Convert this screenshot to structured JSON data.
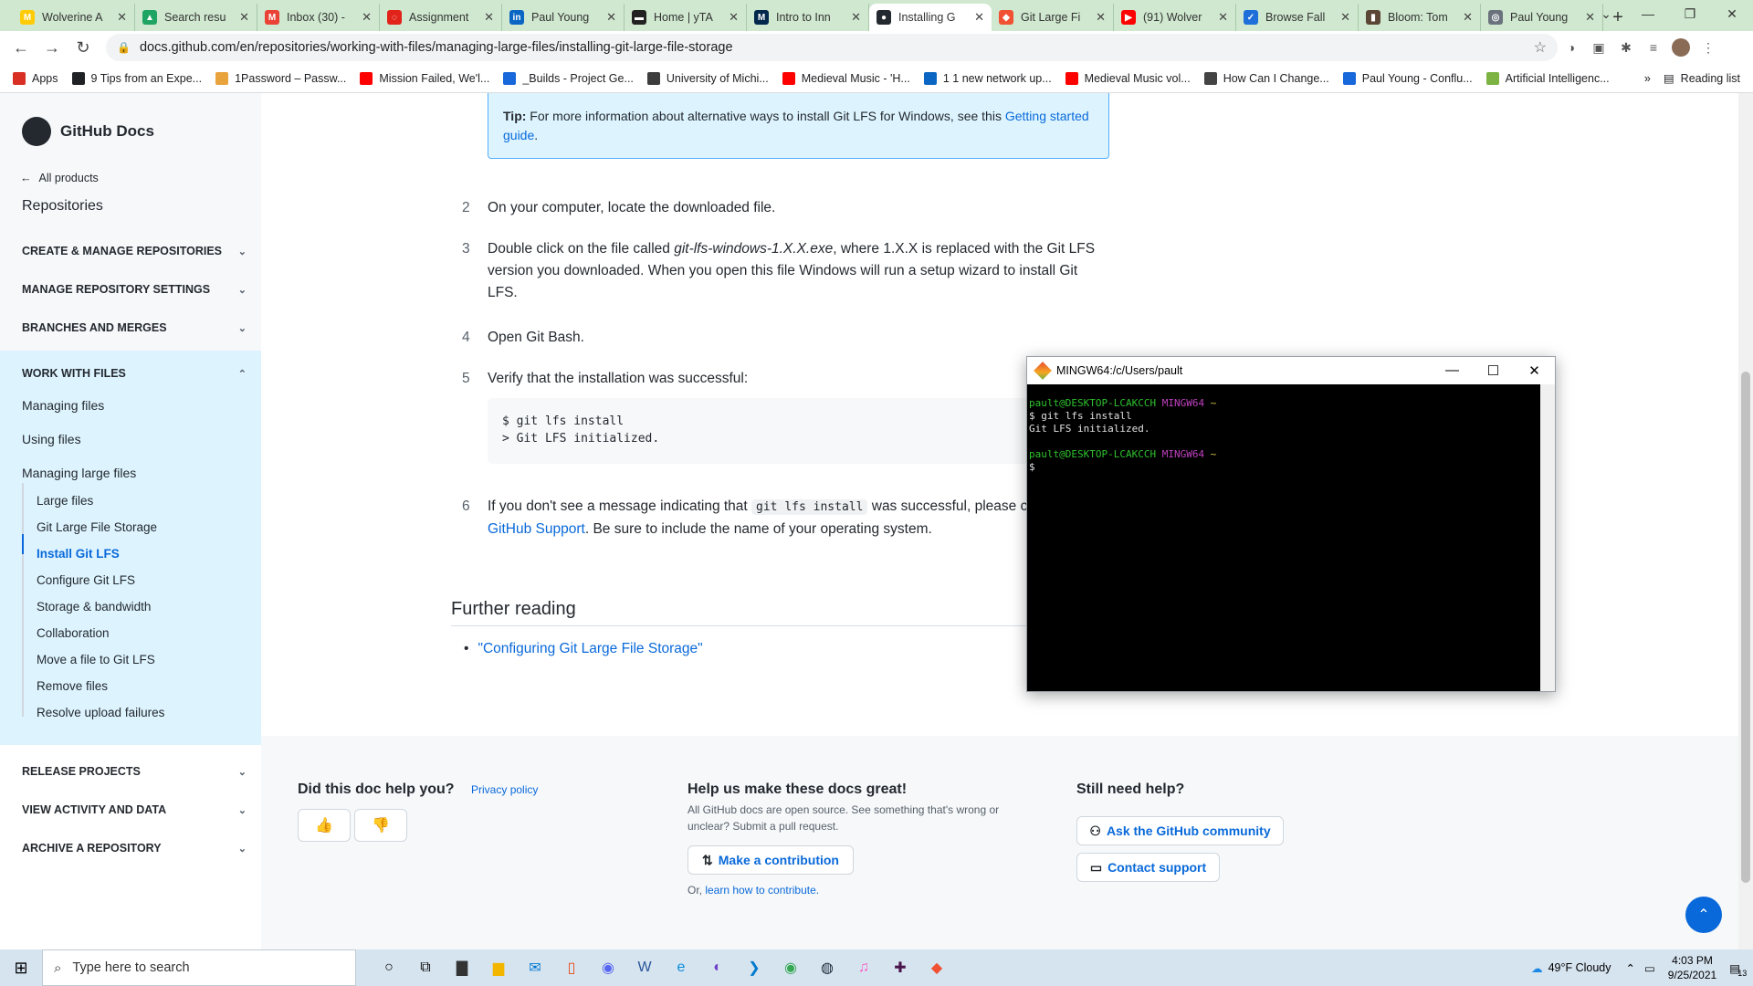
{
  "browser": {
    "tabs": [
      {
        "title": "Wolverine A",
        "fav_color": "#ffcb05",
        "fav_text": "M"
      },
      {
        "title": "Search resu",
        "fav_color": "#1fa463",
        "fav_text": "▲"
      },
      {
        "title": "Inbox (30) -",
        "fav_color": "#ea4335",
        "fav_text": "M"
      },
      {
        "title": "Assignment",
        "fav_color": "#e2231a",
        "fav_text": "◌"
      },
      {
        "title": "Paul Young",
        "fav_color": "#0a66c2",
        "fav_text": "in"
      },
      {
        "title": "Home | yTA",
        "fav_color": "#222222",
        "fav_text": "▬"
      },
      {
        "title": "Intro to Inn",
        "fav_color": "#00274c",
        "fav_text": "M"
      },
      {
        "title": "Installing G",
        "fav_color": "#24292f",
        "fav_text": "●",
        "active": true
      },
      {
        "title": "Git Large Fi",
        "fav_color": "#f05133",
        "fav_text": "◆"
      },
      {
        "title": "(91) Wolver",
        "fav_color": "#ff0000",
        "fav_text": "▶"
      },
      {
        "title": "Browse Fall",
        "fav_color": "#1e6fd9",
        "fav_text": "✓"
      },
      {
        "title": "Bloom: Tom",
        "fav_color": "#5b4636",
        "fav_text": "▮"
      },
      {
        "title": "Paul Young",
        "fav_color": "#6a737d",
        "fav_text": "◎"
      }
    ],
    "url": "docs.github.com/en/repositories/working-with-files/managing-large-files/installing-git-large-file-storage",
    "bookmarks": [
      {
        "label": "Apps",
        "color": "#d93025"
      },
      {
        "label": "9 Tips from an Expe...",
        "color": "#202124"
      },
      {
        "label": "1Password – Passw...",
        "color": "#e8a33d"
      },
      {
        "label": "Mission Failed, We'l...",
        "color": "#ff0000"
      },
      {
        "label": "_Builds - Project Ge...",
        "color": "#1868db"
      },
      {
        "label": "University of Michi...",
        "color": "#3c3c3c"
      },
      {
        "label": "Medieval Music - 'H...",
        "color": "#ff0000"
      },
      {
        "label": "1 1 new network up...",
        "color": "#0a66c2"
      },
      {
        "label": "Medieval Music vol...",
        "color": "#ff0000"
      },
      {
        "label": "How Can I Change...",
        "color": "#444444"
      },
      {
        "label": "Paul Young - Conflu...",
        "color": "#1868db"
      },
      {
        "label": "Artificial Intelligenc...",
        "color": "#7cb342"
      }
    ],
    "bookmarks_more": "»",
    "reading_list": "Reading list"
  },
  "sidebar": {
    "logo_text": "GitHub Docs",
    "all_products": "All products",
    "title": "Repositories",
    "sections_top": [
      {
        "label": "CREATE & MANAGE REPOSITORIES"
      },
      {
        "label": "MANAGE REPOSITORY SETTINGS"
      },
      {
        "label": "BRANCHES AND MERGES"
      }
    ],
    "work_with_files": {
      "label": "WORK WITH FILES",
      "items": [
        "Managing files",
        "Using files",
        "Managing large files"
      ],
      "subitems": [
        "Large files",
        "Git Large File Storage",
        "Install Git LFS",
        "Configure Git LFS",
        "Storage & bandwidth",
        "Collaboration",
        "Move a file to Git LFS",
        "Remove files",
        "Resolve upload failures"
      ]
    },
    "sections_bottom": [
      {
        "label": "RELEASE PROJECTS"
      },
      {
        "label": "VIEW ACTIVITY AND DATA"
      },
      {
        "label": "ARCHIVE A REPOSITORY"
      }
    ]
  },
  "main": {
    "tip_prefix": "Tip:",
    "tip_text": " For more information about alternative ways to install Git LFS for Windows, see this ",
    "tip_link": "Getting started guide",
    "tip_suffix": ".",
    "step2_num": "2",
    "step2": "On your computer, locate the downloaded file.",
    "step3_num": "3",
    "step3_a": "Double click on the file called ",
    "step3_file": "git-lfs-windows-1.X.X.exe",
    "step3_b": ", where 1.X.X is replaced with the Git LFS version you downloaded. When you open this file Windows will run a setup wizard to install Git LFS.",
    "step4_num": "4",
    "step4": "Open Git Bash.",
    "step5_num": "5",
    "step5": "Verify that the installation was successful:",
    "code_line1": "$ git lfs install",
    "code_line2": "> Git LFS initialized.",
    "step6_num": "6",
    "step6_a": "If you don't see a message indicating that ",
    "step6_code": "git lfs install",
    "step6_b": " was successful, please contact ",
    "step6_link": "GitHub Support",
    "step6_c": ". Be sure to include the name of your operating system.",
    "further_heading": "Further reading",
    "further_link": "\"Configuring Git Large File Storage\""
  },
  "footer": {
    "help_q": "Did this doc help you?",
    "privacy": "Privacy policy",
    "thumbs_up": "👍",
    "thumbs_down": "👎",
    "make_great": "Help us make these docs great!",
    "make_great_desc": "All GitHub docs are open source. See something that's wrong or unclear? Submit a pull request.",
    "contribute_btn": "Make a contribution",
    "or": "Or, ",
    "learn_link": "learn how to contribute.",
    "still_help": "Still need help?",
    "community_btn": "Ask the GitHub community",
    "support_btn": "Contact support"
  },
  "bash": {
    "title": "MINGW64:/c/Users/pault",
    "user_host": "pault@DESKTOP-LCAKCCH",
    "env": "MINGW64",
    "dir": "~",
    "cmd": "$ git lfs install",
    "output": "Git LFS initialized.",
    "prompt": "$"
  },
  "taskbar": {
    "search_placeholder": "Type here to search",
    "apps": [
      {
        "name": "cortana",
        "glyph": "○",
        "color": "#000000"
      },
      {
        "name": "task-view",
        "glyph": "⧉",
        "color": "#000000"
      },
      {
        "name": "store",
        "glyph": "▇",
        "color": "#333333"
      },
      {
        "name": "file-explorer",
        "glyph": "▆",
        "color": "#f2b600"
      },
      {
        "name": "mail",
        "glyph": "✉",
        "color": "#0078d4"
      },
      {
        "name": "office",
        "glyph": "▯",
        "color": "#e64a19"
      },
      {
        "name": "discord",
        "glyph": "◉",
        "color": "#5865f2"
      },
      {
        "name": "word",
        "glyph": "W",
        "color": "#2b579a"
      },
      {
        "name": "edge",
        "glyph": "e",
        "color": "#0c8cdc"
      },
      {
        "name": "github-desktop",
        "glyph": "◐",
        "color": "#6e40c9"
      },
      {
        "name": "vscode",
        "glyph": "❯",
        "color": "#007acc"
      },
      {
        "name": "chrome",
        "glyph": "◉",
        "color": "#34a853"
      },
      {
        "name": "steam",
        "glyph": "◍",
        "color": "#1b2838"
      },
      {
        "name": "itunes",
        "glyph": "♫",
        "color": "#fb5bc5"
      },
      {
        "name": "slack",
        "glyph": "✚",
        "color": "#4a154b"
      },
      {
        "name": "git-gui",
        "glyph": "◆",
        "color": "#f05133"
      }
    ],
    "weather": "49°F  Cloudy",
    "time": "4:03 PM",
    "date": "9/25/2021",
    "notifications": "13"
  }
}
